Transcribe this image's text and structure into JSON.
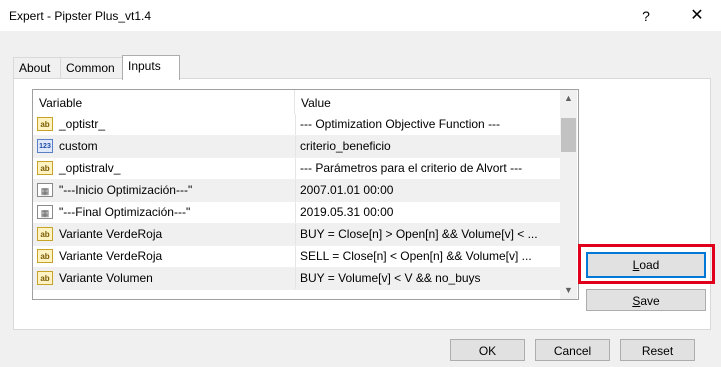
{
  "window": {
    "title": "Expert - Pipster Plus_vt1.4",
    "help_glyph": "?",
    "close_glyph": "✕"
  },
  "tabs": [
    {
      "label": "About",
      "active": false
    },
    {
      "label": "Common",
      "active": false
    },
    {
      "label": "Inputs",
      "active": true
    }
  ],
  "grid": {
    "columns": {
      "variable": "Variable",
      "value": "Value"
    },
    "rows": [
      {
        "icon": "ab",
        "variable": "_optistr_",
        "value": "--- Optimization Objective Function ---"
      },
      {
        "icon": "123",
        "variable": "custom",
        "value": "criterio_beneficio"
      },
      {
        "icon": "ab",
        "variable": "_optistralv_",
        "value": "--- Parámetros para el criterio de Alvort ---"
      },
      {
        "icon": "date",
        "variable": "\"---Inicio Optimización---\"",
        "value": "2007.01.01 00:00"
      },
      {
        "icon": "date",
        "variable": "\"---Final Optimización---\"",
        "value": "2019.05.31 00:00"
      },
      {
        "icon": "ab",
        "variable": "Variante VerdeRoja",
        "value": "BUY = Close[n] > Open[n] && Volume[v] < ..."
      },
      {
        "icon": "ab",
        "variable": "Variante VerdeRoja",
        "value": "SELL = Close[n] < Open[n] && Volume[v] ..."
      },
      {
        "icon": "ab",
        "variable": "Variante Volumen",
        "value": "BUY = Volume[v] < V && no_buys"
      }
    ],
    "scroll_up_glyph": "▲",
    "scroll_down_glyph": "▼"
  },
  "buttons": {
    "load": {
      "accel": "L",
      "rest": "oad"
    },
    "save": {
      "accel": "S",
      "rest": "ave"
    },
    "ok": "OK",
    "cancel": "Cancel",
    "reset": "Reset"
  },
  "colors": {
    "highlight": "#e0001b",
    "focus": "#0078d7"
  }
}
